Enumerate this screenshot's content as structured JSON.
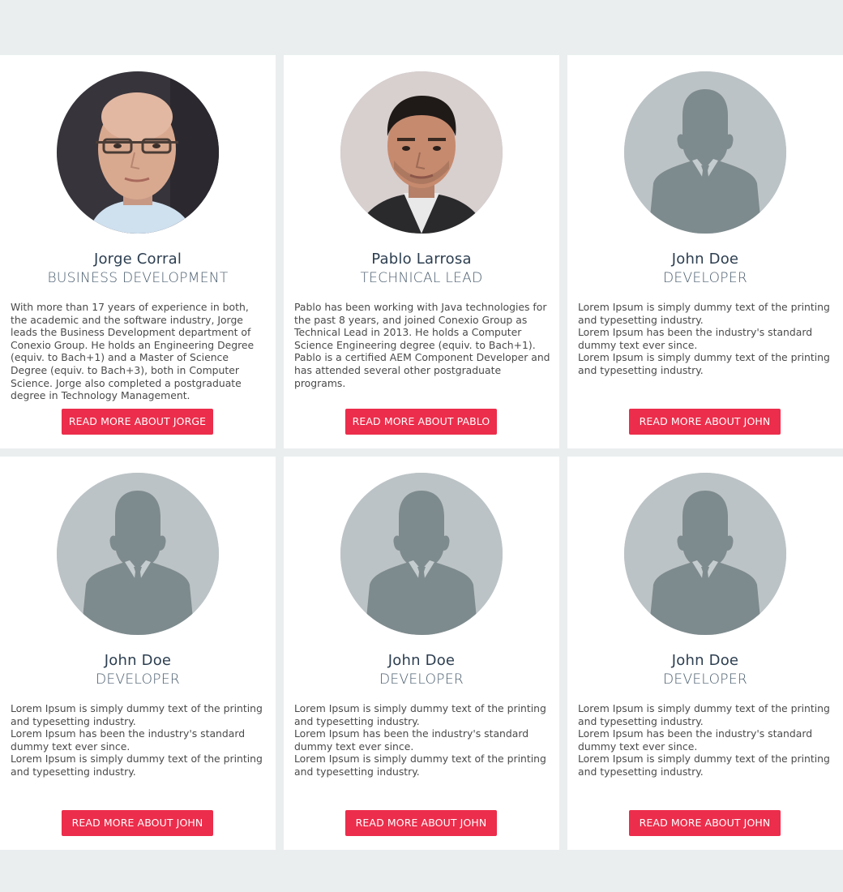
{
  "colors": {
    "page_background": "#eaeeef",
    "card_background": "#ffffff",
    "accent": "#ec2d4b",
    "name_text": "#2c3e50",
    "role_text": "#4a5d6e",
    "body_text": "#4a4a4a",
    "placeholder_avatar_bg": "#bcc3c6",
    "placeholder_avatar_fg": "#7e8b8e"
  },
  "team": [
    {
      "name": "Jorge Corral",
      "role": "BUSINESS DEVELOPMENT",
      "bio": "With more than 17 years of experience in both, the academic and the software industry, Jorge leads the Business Development department of Conexio Group. He holds an Engineering Degree (equiv. to Bach+1) and a Master of Science Degree (equiv. to Bach+3), both in Computer Science. Jorge also completed a postgraduate degree in Technology Management.",
      "button_label": "READ MORE ABOUT JORGE",
      "avatar": "photo-bald-man-glasses"
    },
    {
      "name": "Pablo Larrosa",
      "role": "TECHNICAL LEAD",
      "bio": "Pablo has been working with Java technologies for the past 8 years, and joined Conexio Group as Technical Lead in 2013. He holds a Computer Science Engineering degree (equiv. to Bach+1). Pablo is a certified AEM Component Developer and has attended several other postgraduate programs.",
      "button_label": "READ MORE ABOUT PABLO",
      "avatar": "photo-man-dark-hair"
    },
    {
      "name": "John Doe",
      "role": "DEVELOPER",
      "bio": "Lorem Ipsum is simply dummy text of the printing and typesetting industry.\nLorem Ipsum has been the industry's standard dummy text ever since.\nLorem Ipsum is simply dummy text of the printing and typesetting industry.",
      "button_label": "READ MORE ABOUT JOHN",
      "avatar": "placeholder-person-icon"
    },
    {
      "name": "John Doe",
      "role": "DEVELOPER",
      "bio": "Lorem Ipsum is simply dummy text of the printing and typesetting industry.\nLorem Ipsum has been the industry's standard dummy text ever since.\nLorem Ipsum is simply dummy text of the printing and typesetting industry.",
      "button_label": "READ MORE ABOUT JOHN",
      "avatar": "placeholder-person-icon"
    },
    {
      "name": "John Doe",
      "role": "DEVELOPER",
      "bio": "Lorem Ipsum is simply dummy text of the printing and typesetting industry.\nLorem Ipsum has been the industry's standard dummy text ever since.\nLorem Ipsum is simply dummy text of the printing and typesetting industry.",
      "button_label": "READ MORE ABOUT JOHN",
      "avatar": "placeholder-person-icon"
    },
    {
      "name": "John Doe",
      "role": "DEVELOPER",
      "bio": "Lorem Ipsum is simply dummy text of the printing and typesetting industry.\nLorem Ipsum has been the industry's standard dummy text ever since.\nLorem Ipsum is simply dummy text of the printing and typesetting industry.",
      "button_label": "READ MORE ABOUT JOHN",
      "avatar": "placeholder-person-icon"
    }
  ]
}
